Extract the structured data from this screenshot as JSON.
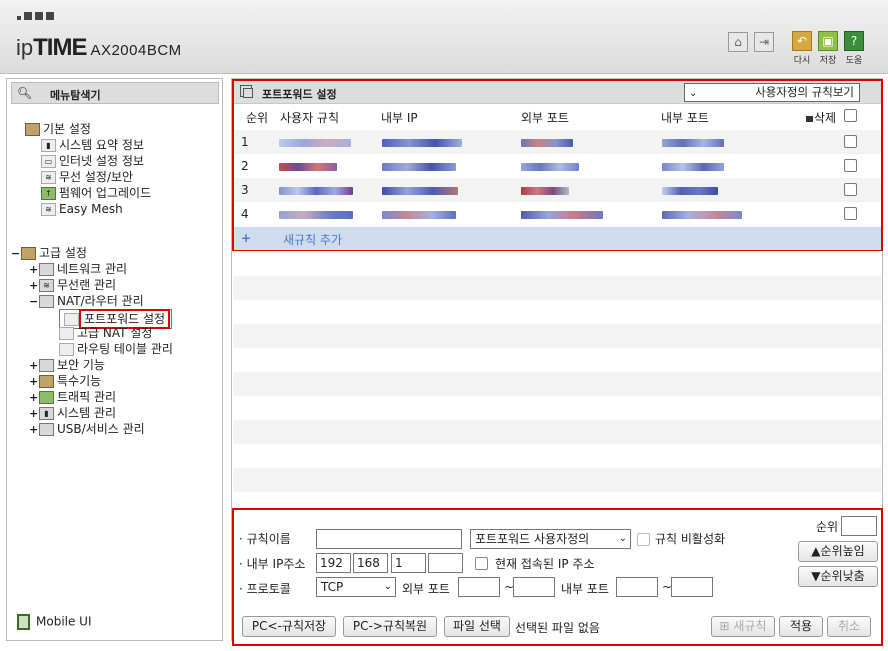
{
  "header": {
    "brand_prefix": "ip",
    "brand_name": "TIME",
    "model": "AX2004BCM",
    "tools": [
      {
        "label": "다시",
        "icon": "undo-icon",
        "color": "#d7a93c"
      },
      {
        "label": "저장",
        "icon": "save-icon",
        "color": "#8fc04a"
      },
      {
        "label": "도움",
        "icon": "help-icon",
        "color": "#3c8f3a"
      }
    ]
  },
  "sidebar": {
    "finder_label": "메뉴탐색기",
    "groups": [
      {
        "label": "기본 설정",
        "items": [
          "시스템 요약 정보",
          "인터넷 설정 정보",
          "무선 설정/보안",
          "펌웨어 업그레이드",
          "Easy Mesh"
        ]
      },
      {
        "label": "고급 설정",
        "items": [
          {
            "label": "네트워크 관리",
            "expand": "+"
          },
          {
            "label": "무선랜 관리",
            "expand": "+"
          },
          {
            "label": "NAT/라우터 관리",
            "expand": "−",
            "children": [
              "포트포워드 설정",
              "고급 NAT 설정",
              "라우팅 테이블 관리"
            ]
          },
          {
            "label": "보안 기능",
            "expand": "+"
          },
          {
            "label": "특수기능",
            "expand": "+"
          },
          {
            "label": "트래픽 관리",
            "expand": "+"
          },
          {
            "label": "시스템 관리",
            "expand": "+"
          },
          {
            "label": "USB/서비스 관리",
            "expand": "+"
          }
        ]
      }
    ],
    "mobile_label": "Mobile UI"
  },
  "list": {
    "title": "포트포워드 설정",
    "view_select": "사용자정의 규칙보기",
    "columns": {
      "no": "순위",
      "rule": "사용자 규칙",
      "internal_ip": "내부 IP",
      "external_port": "외부 포트",
      "internal_port": "내부 포트",
      "delete": "삭제"
    },
    "rows": [
      {
        "no": "1"
      },
      {
        "no": "2"
      },
      {
        "no": "3"
      },
      {
        "no": "4"
      }
    ],
    "add_plus": "+",
    "add_label": "새규칙 추가"
  },
  "form": {
    "rule_name_label": "· 규칙이름",
    "rule_type": "포트포워드 사용자정의",
    "disable_label": "규칙 비활성화",
    "priority_label": "순위",
    "ip_label": "· 내부 IP주소",
    "ip": [
      "192",
      "168",
      "1",
      ""
    ],
    "current_ip_label": "현재 접속된 IP 주소",
    "move_up": "▲순위높임",
    "protocol_label": "· 프로토콜",
    "protocol": "TCP",
    "external_port_label": "외부 포트",
    "tilde": "~",
    "internal_port_label": "내부 포트",
    "move_down": "▼순위낮춤",
    "btn_backup": "PC<-규칙저장",
    "btn_restore": "PC->규칙복원",
    "btn_file": "파일 선택",
    "file_status": "선택된 파일 없음",
    "btn_new": "새규칙",
    "btn_apply": "적용",
    "btn_cancel": "취소"
  }
}
